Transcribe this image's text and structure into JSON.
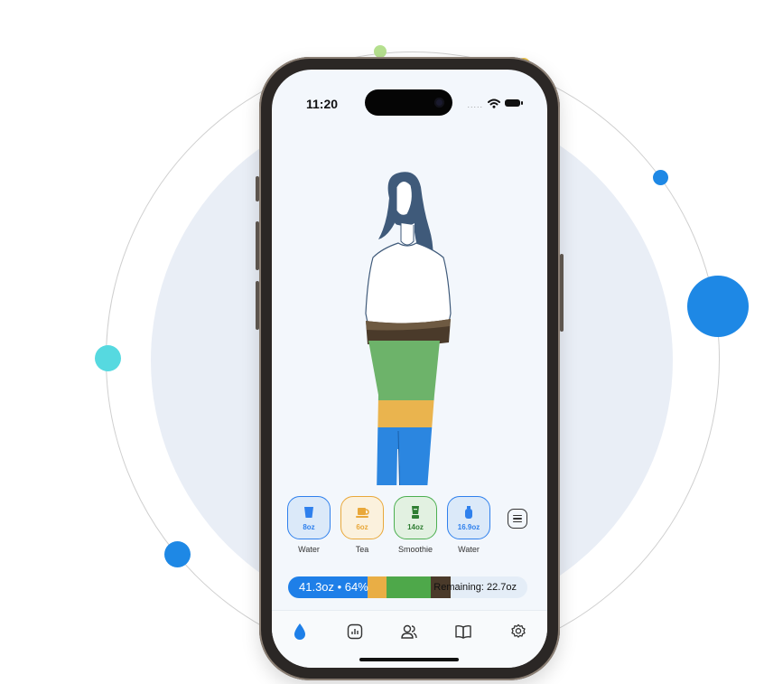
{
  "status_bar": {
    "time": "11:20",
    "signal": "....."
  },
  "drinks": [
    {
      "amount": "8oz",
      "label": "Water",
      "icon": "cup-icon",
      "color": "#2f80ed",
      "fill": "#dbe9f9"
    },
    {
      "amount": "6oz",
      "label": "Tea",
      "icon": "teapot-icon",
      "color": "#e9a83a",
      "fill": "#fbf1dd"
    },
    {
      "amount": "14oz",
      "label": "Smoothie",
      "icon": "blender-icon",
      "color": "#4caf50",
      "fill": "#e2f1e1"
    },
    {
      "amount": "16.9oz",
      "label": "Water",
      "icon": "bottle-icon",
      "color": "#2f80ed",
      "fill": "#dbe9f9"
    }
  ],
  "menu_icon": "list-icon",
  "progress": {
    "text": "41.3oz • 64%",
    "remaining": "Remaining: 22.7oz",
    "percent": 64,
    "segments": [
      {
        "drink": "Water",
        "color": "#1e7fe8",
        "oz": 24.9
      },
      {
        "drink": "Tea",
        "color": "#e9ae45",
        "oz": 6
      },
      {
        "drink": "Smoothie",
        "color": "#4ea84a",
        "oz": 14
      },
      {
        "drink": "Coffee",
        "color": "#4a3a2a",
        "oz": 6
      }
    ]
  },
  "tabs": [
    {
      "name": "tab-hydration",
      "icon": "water-drop-icon",
      "active": true
    },
    {
      "name": "tab-stats",
      "icon": "chart-icon",
      "active": false
    },
    {
      "name": "tab-friends",
      "icon": "people-icon",
      "active": false
    },
    {
      "name": "tab-journal",
      "icon": "book-icon",
      "active": false
    },
    {
      "name": "tab-settings",
      "icon": "gear-icon",
      "active": false
    }
  ]
}
